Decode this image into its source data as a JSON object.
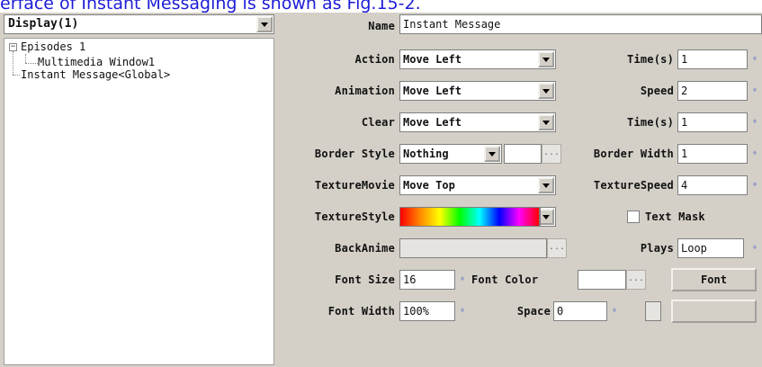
{
  "caption": "erface of Instant Messaging is shown as Fig.15-2.",
  "left": {
    "dropdown_value": "Display(1)",
    "tree": {
      "root": "Episodes 1",
      "child": "Multimedia Window1",
      "sibling": "Instant Message<Global>"
    }
  },
  "form": {
    "name_label": "Name",
    "name_value": "Instant Message",
    "action_label": "Action",
    "action_value": "Move Left",
    "time1_label": "Time(s)",
    "time1_value": "1",
    "animation_label": "Animation",
    "animation_value": "Move Left",
    "speed_label": "Speed",
    "speed_value": "2",
    "clear_label": "Clear",
    "clear_value": "Move Left",
    "time2_label": "Time(s)",
    "time2_value": "1",
    "border_style_label": "Border Style",
    "border_style_value": "Nothing",
    "border_width_label": "Border Width",
    "border_width_value": "1",
    "texture_movie_label": "TextureMovie",
    "texture_movie_value": "Move Top",
    "texture_speed_label": "TextureSpeed",
    "texture_speed_value": "4",
    "texture_style_label": "TextureStyle",
    "text_mask_label": "Text Mask",
    "back_anime_label": "BackAnime",
    "back_anime_value": "",
    "plays_label": "Plays",
    "plays_value": "Loop",
    "font_size_label": "Font Size",
    "font_size_value": "16",
    "font_color_label": "Font Color",
    "font_button_label": "Font",
    "font_width_label": "Font Width",
    "font_width_value": "100%",
    "space_label": "Space",
    "space_value": "0",
    "ellipsis": "...",
    "spin_glyph": "♦"
  },
  "colors": {
    "caption": "#1c1cd8",
    "window_bg": "#d4d0c8"
  }
}
